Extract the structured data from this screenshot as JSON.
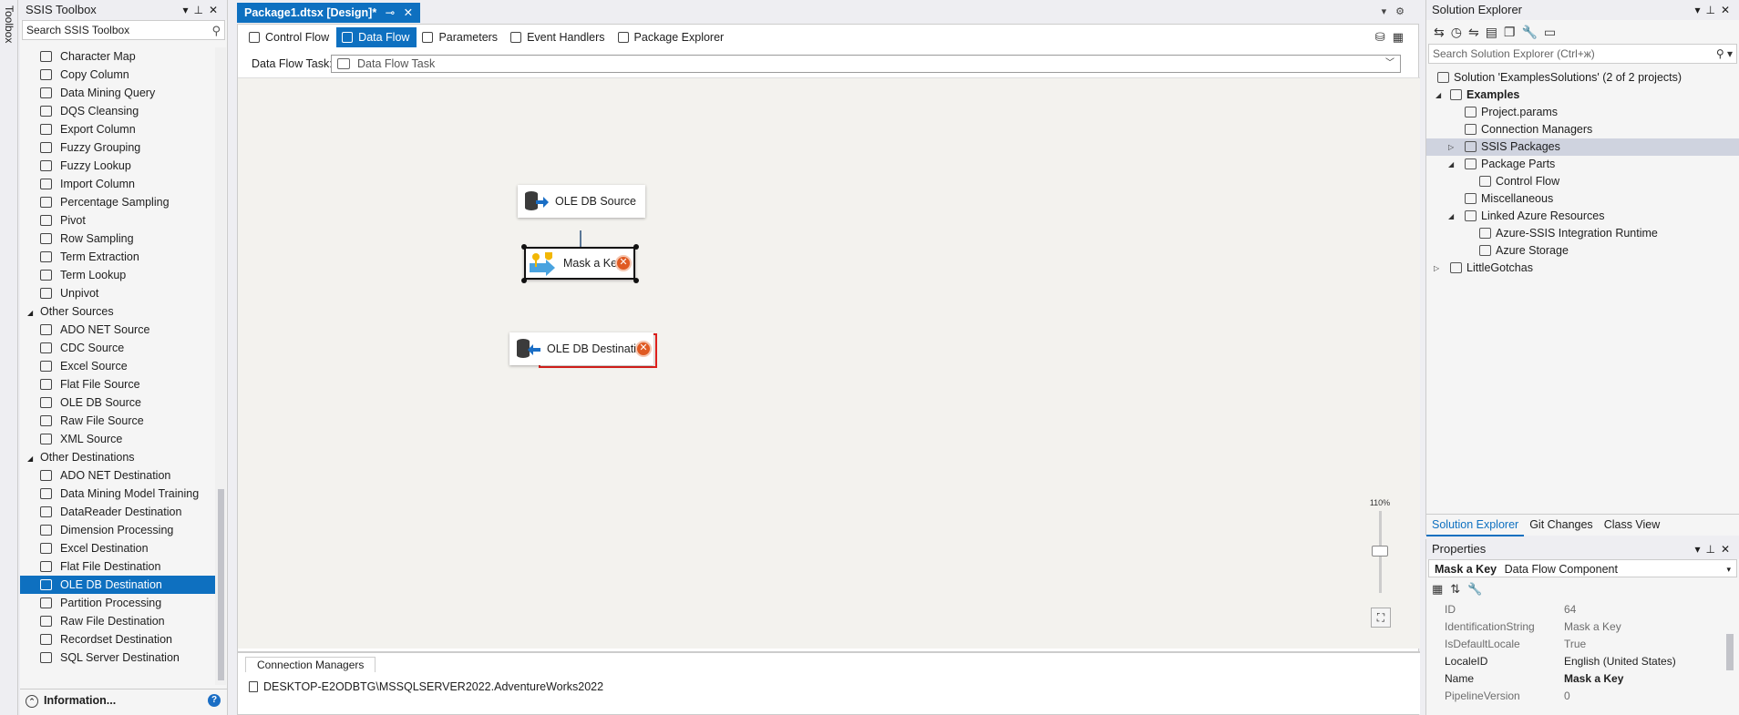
{
  "toolbox_strip": {
    "label": "Toolbox"
  },
  "ssis_toolbox": {
    "title": "SSIS Toolbox",
    "search_value": "Search SSIS Toolbox",
    "transform_items": [
      "Character Map",
      "Copy Column",
      "Data Mining Query",
      "DQS Cleansing",
      "Export Column",
      "Fuzzy Grouping",
      "Fuzzy Lookup",
      "Import Column",
      "Percentage Sampling",
      "Pivot",
      "Row Sampling",
      "Term Extraction",
      "Term Lookup",
      "Unpivot"
    ],
    "sources_group": "Other Sources",
    "source_items": [
      "ADO NET Source",
      "CDC Source",
      "Excel Source",
      "Flat File Source",
      "OLE DB Source",
      "Raw File Source",
      "XML Source"
    ],
    "destinations_group": "Other Destinations",
    "destination_items": [
      "ADO NET Destination",
      "Data Mining Model Training",
      "DataReader Destination",
      "Dimension Processing",
      "Excel Destination",
      "Flat File Destination",
      "OLE DB Destination",
      "Partition Processing",
      "Raw File Destination",
      "Recordset Destination",
      "SQL Server Destination"
    ],
    "selected_item": "OLE DB Destination",
    "info_label": "Information..."
  },
  "document": {
    "tab_title": "Package1.dtsx [Design]*",
    "designer_tabs": [
      "Control Flow",
      "Data Flow",
      "Parameters",
      "Event Handlers",
      "Package Explorer"
    ],
    "active_tab": "Data Flow",
    "task_label": "Data Flow Task:",
    "task_value": "Data Flow Task",
    "components": {
      "source": "OLE DB Source",
      "transform": "Mask a Key",
      "destination": "OLE DB Destination"
    },
    "zoom": "110%",
    "connection_managers_tab": "Connection Managers",
    "connection": "DESKTOP-E2ODBTG\\MSSQLSERVER2022.AdventureWorks2022"
  },
  "solution_explorer": {
    "title": "Solution Explorer",
    "search_placeholder": "Search Solution Explorer (Ctrl+ж)",
    "tree": [
      {
        "label": "Solution 'ExamplesSolutions' (2 of 2 projects)"
      },
      {
        "label": "Examples"
      },
      {
        "label": "Project.params"
      },
      {
        "label": "Connection Managers"
      },
      {
        "label": "SSIS Packages"
      },
      {
        "label": "Package Parts"
      },
      {
        "label": "Control Flow"
      },
      {
        "label": "Miscellaneous"
      },
      {
        "label": "Linked Azure Resources"
      },
      {
        "label": "Azure-SSIS Integration Runtime"
      },
      {
        "label": "Azure Storage"
      },
      {
        "label": "LittleGotchas"
      }
    ],
    "bottom_tabs": [
      "Solution Explorer",
      "Git Changes",
      "Class View"
    ]
  },
  "properties": {
    "title": "Properties",
    "object_name": "Mask a Key",
    "object_type": "Data Flow Component",
    "rows": [
      {
        "name": "ID",
        "value": "64"
      },
      {
        "name": "IdentificationString",
        "value": "Mask a Key"
      },
      {
        "name": "IsDefaultLocale",
        "value": "True"
      },
      {
        "name": "LocaleID",
        "value": "English (United States)"
      },
      {
        "name": "Name",
        "value": "Mask a Key"
      },
      {
        "name": "PipelineVersion",
        "value": "0"
      }
    ]
  },
  "colors": {
    "accent": "#0e70c0",
    "error": "#e05a22",
    "highlight_box": "#e0201c",
    "canvas": "#f3f2ee"
  }
}
